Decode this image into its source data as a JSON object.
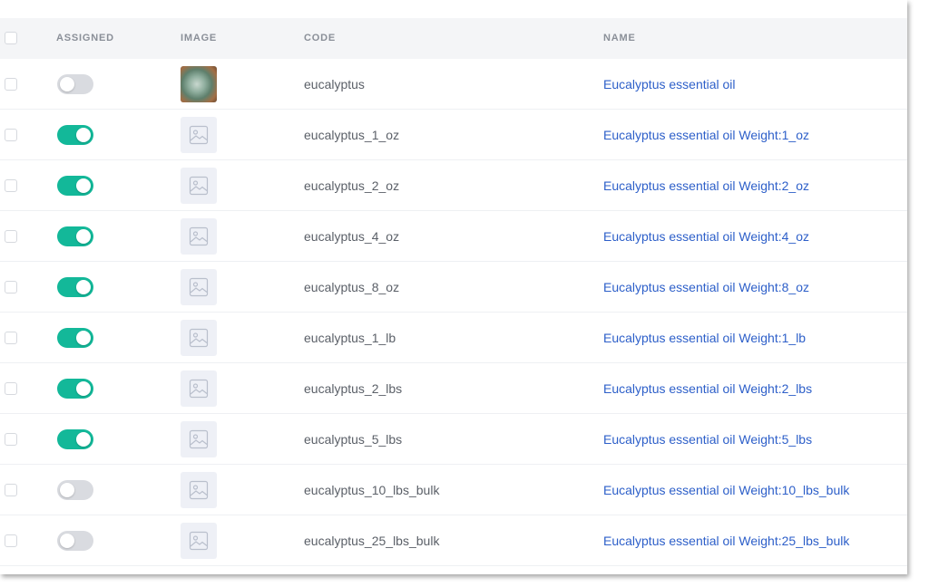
{
  "header": {
    "assigned": "ASSIGNED",
    "image": "IMAGE",
    "code": "CODE",
    "name": "NAME"
  },
  "colors": {
    "toggle_on": "#13b899",
    "toggle_off": "#d9dbe0",
    "name_link": "#2d5fc9"
  },
  "rows": [
    {
      "assigned": false,
      "image": "product-photo",
      "code": "eucalyptus",
      "name": "Eucalyptus essential oil"
    },
    {
      "assigned": true,
      "image": "image-placeholder-icon",
      "code": "eucalyptus_1_oz",
      "name": "Eucalyptus essential oil Weight:1_oz"
    },
    {
      "assigned": true,
      "image": "image-placeholder-icon",
      "code": "eucalyptus_2_oz",
      "name": "Eucalyptus essential oil Weight:2_oz"
    },
    {
      "assigned": true,
      "image": "image-placeholder-icon",
      "code": "eucalyptus_4_oz",
      "name": "Eucalyptus essential oil Weight:4_oz"
    },
    {
      "assigned": true,
      "image": "image-placeholder-icon",
      "code": "eucalyptus_8_oz",
      "name": "Eucalyptus essential oil Weight:8_oz"
    },
    {
      "assigned": true,
      "image": "image-placeholder-icon",
      "code": "eucalyptus_1_lb",
      "name": "Eucalyptus essential oil Weight:1_lb"
    },
    {
      "assigned": true,
      "image": "image-placeholder-icon",
      "code": "eucalyptus_2_lbs",
      "name": "Eucalyptus essential oil Weight:2_lbs"
    },
    {
      "assigned": true,
      "image": "image-placeholder-icon",
      "code": "eucalyptus_5_lbs",
      "name": "Eucalyptus essential oil Weight:5_lbs"
    },
    {
      "assigned": false,
      "image": "image-placeholder-icon",
      "code": "eucalyptus_10_lbs_bulk",
      "name": "Eucalyptus essential oil Weight:10_lbs_bulk"
    },
    {
      "assigned": false,
      "image": "image-placeholder-icon",
      "code": "eucalyptus_25_lbs_bulk",
      "name": "Eucalyptus essential oil Weight:25_lbs_bulk"
    }
  ]
}
